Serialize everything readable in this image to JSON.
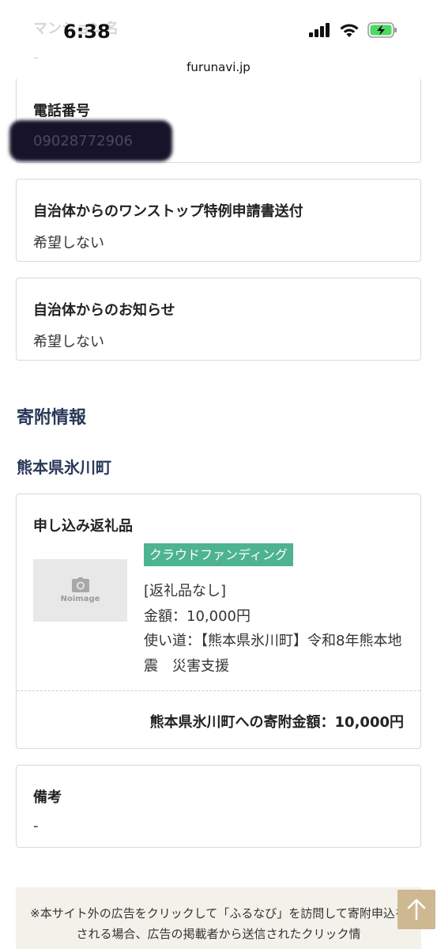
{
  "status_bar": {
    "time": "6:38",
    "url": "furunavi.jp",
    "ghost_label": "マンション名",
    "ghost_value": "-"
  },
  "phone": {
    "title": "電話番号",
    "value": "09028772906"
  },
  "onestop": {
    "title": "自治体からのワンストップ特例申請書送付",
    "value": "希望しない"
  },
  "notice": {
    "title": "自治体からのお知らせ",
    "value": "希望しない"
  },
  "donation_section": {
    "heading": "寄附情報",
    "municipality": "熊本県氷川町"
  },
  "gift": {
    "title": "申し込み返礼品",
    "noimage": "Noimage",
    "tag": "クラウドファンディング",
    "name": "[返礼品なし]",
    "amount": "金額：10,000円",
    "usage_label": "使い道：",
    "usage_text": "【熊本県氷川町】令和8年熊本地震　災害支援",
    "total": "熊本県氷川町への寄附金額：10,000円"
  },
  "remarks": {
    "title": "備考",
    "value": "-"
  },
  "footer_notice": {
    "text": "※本サイト外の広告をクリックして「ふるなび」を訪問して寄附申込をされる場合、広告の掲載者から送信されたクリック情"
  },
  "colors": {
    "heading": "#2a3858",
    "tag_bg": "#4db391",
    "scroll_top_bg": "#cdb892",
    "notice_bg": "#f4f1ea"
  },
  "icons": {
    "noimage": "camera-icon",
    "scroll_top": "arrow-up-icon"
  }
}
